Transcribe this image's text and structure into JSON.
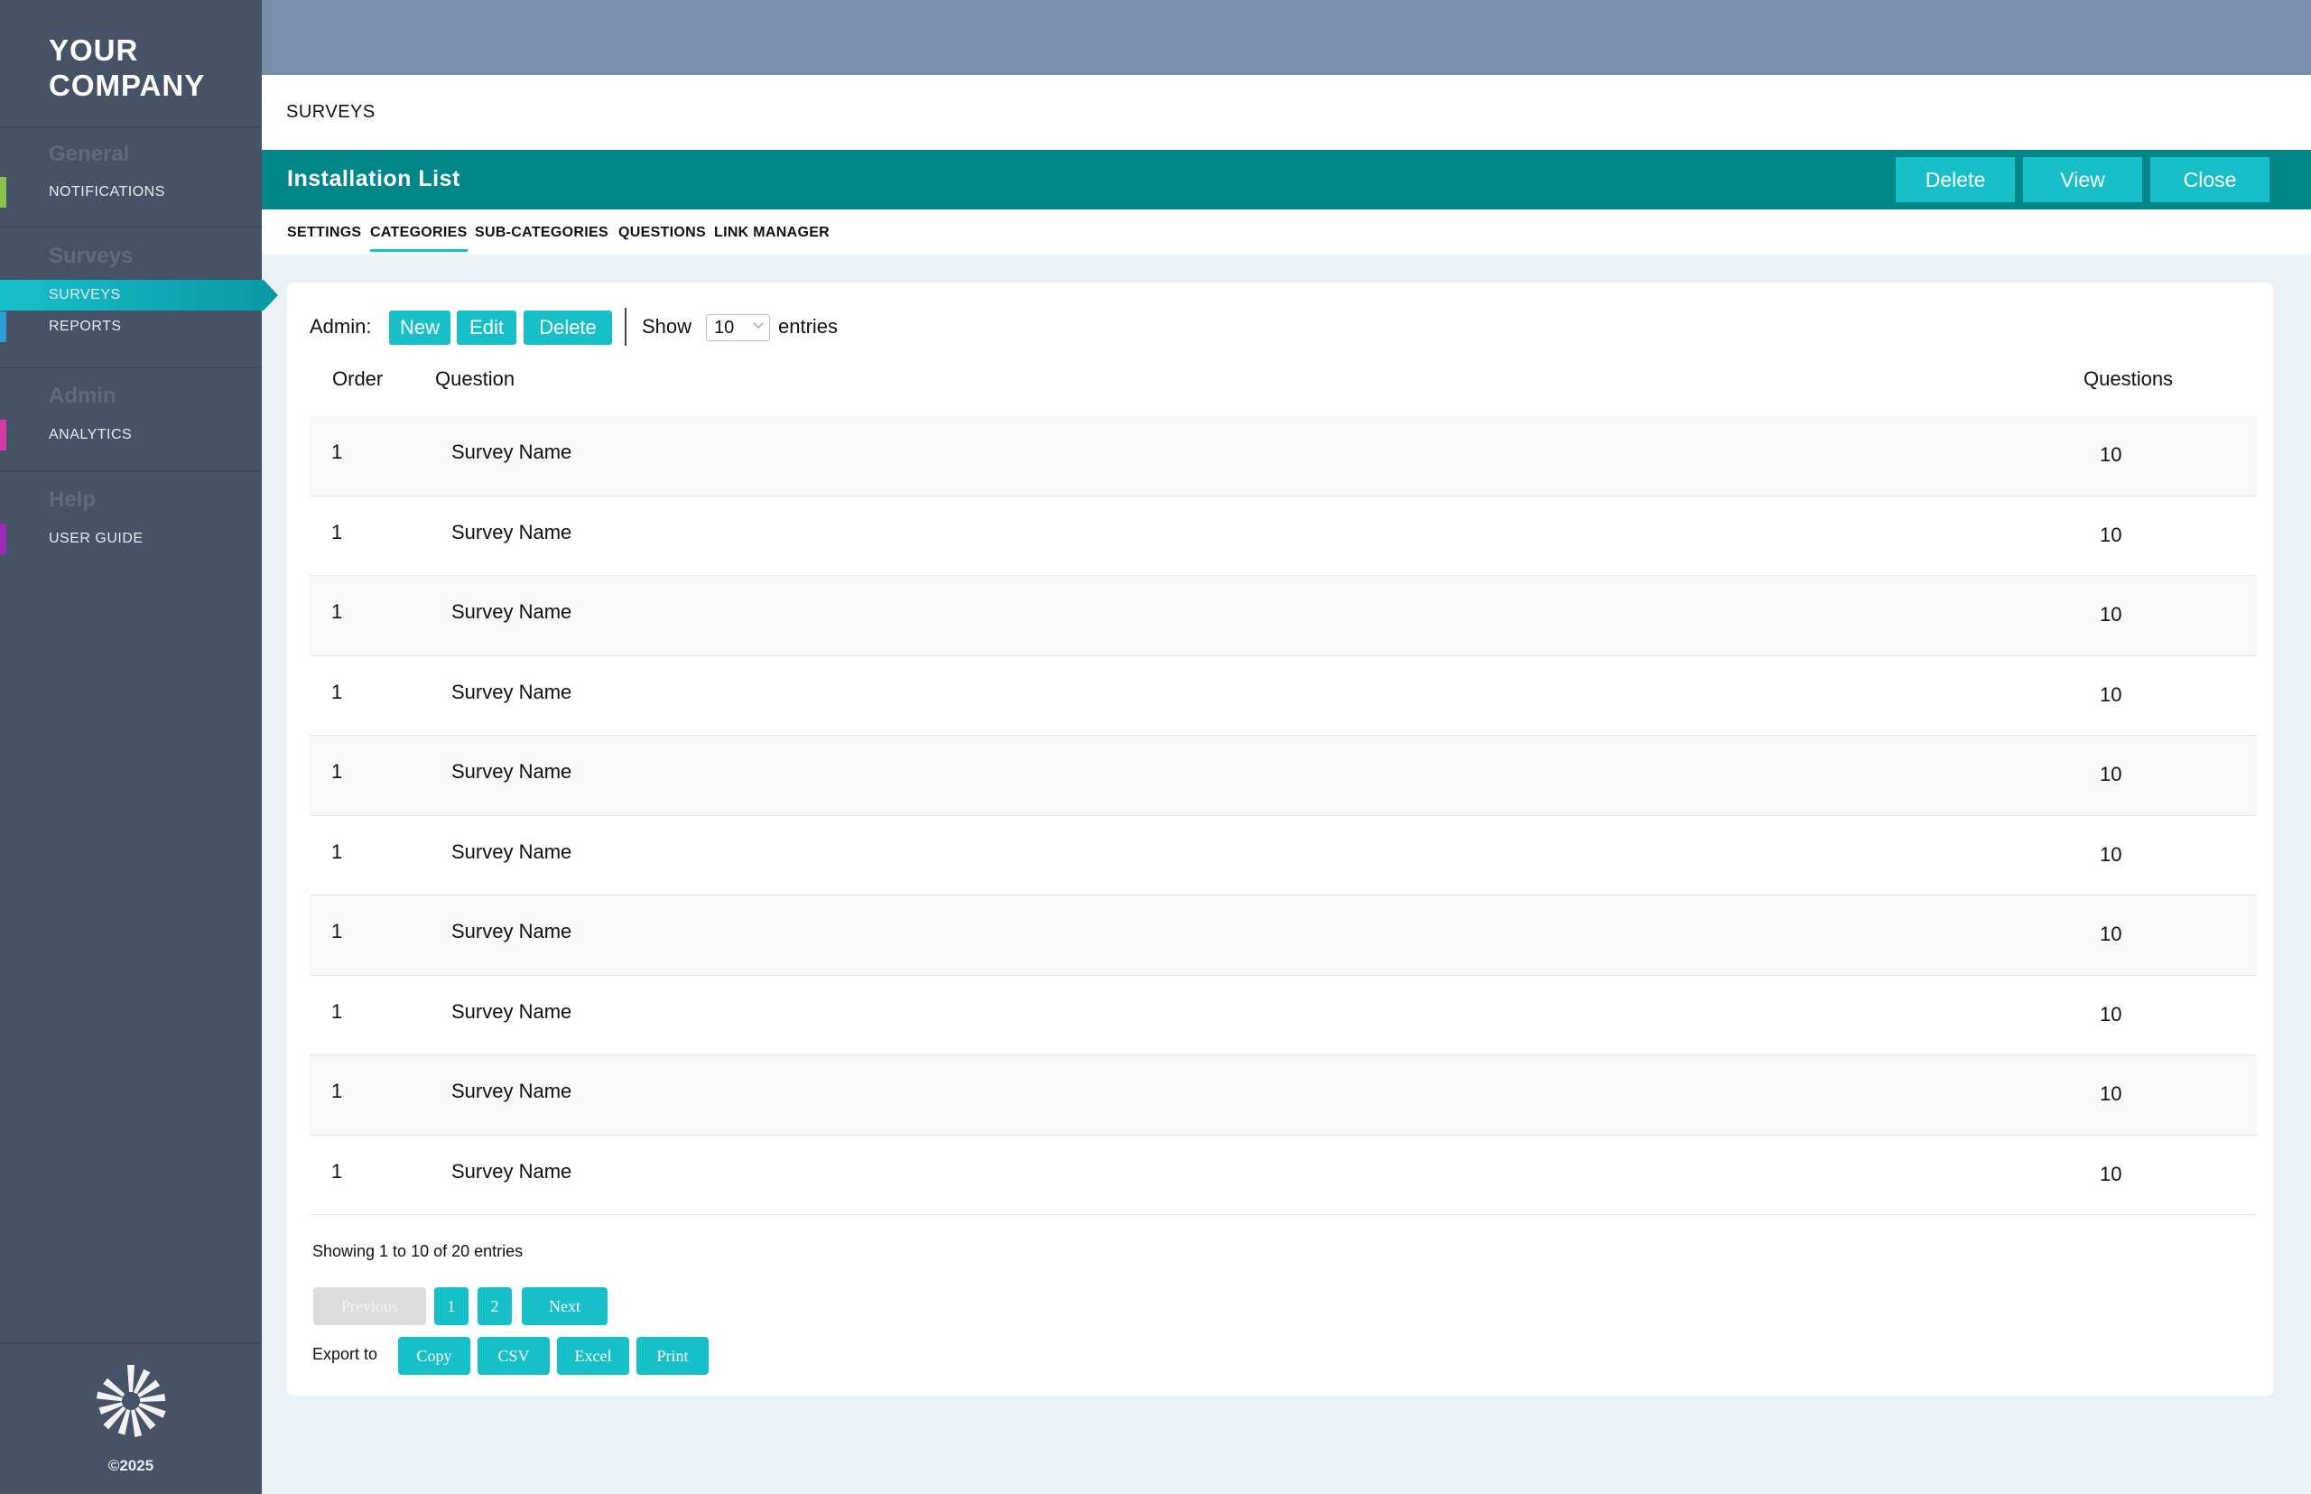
{
  "sidebar": {
    "logo_line1": "YOUR",
    "logo_line2": "COMPANY",
    "sections": [
      {
        "heading": "General",
        "items": [
          {
            "label": "NOTIFICATIONS",
            "accent": "#8bc34a"
          }
        ]
      },
      {
        "heading": "Surveys",
        "items": [
          {
            "label": "SURVEYS",
            "accent": "#17c0c9"
          },
          {
            "label": "REPORTS",
            "accent": "#2a9fd8"
          }
        ]
      },
      {
        "heading": "Admin",
        "items": [
          {
            "label": "ANALYTICS",
            "accent": "#d63aa8"
          }
        ]
      },
      {
        "heading": "Help",
        "items": [
          {
            "label": "USER GUIDE",
            "accent": "#9b2ab8"
          }
        ]
      }
    ],
    "copyright": "©2025"
  },
  "page": {
    "title": "SURVEYS",
    "header_title": "Installation List",
    "header_buttons": {
      "delete": "Delete",
      "view": "View",
      "close": "Close"
    }
  },
  "tabs": [
    "SETTINGS",
    "CATEGORIES",
    "SUB-CATEGORIES",
    "QUESTIONS",
    "LINK MANAGER"
  ],
  "active_tab": "CATEGORIES",
  "admin": {
    "label": "Admin:",
    "new": "New",
    "edit": "Edit",
    "delete": "Delete",
    "show_label": "Show",
    "show_value": "10",
    "entries_label": "entries"
  },
  "table": {
    "columns": [
      "Order",
      "Question",
      "Questions"
    ],
    "rows": [
      [
        "1",
        "Survey Name",
        "10"
      ],
      [
        "1",
        "Survey Name",
        "10"
      ],
      [
        "1",
        "Survey Name",
        "10"
      ],
      [
        "1",
        "Survey Name",
        "10"
      ],
      [
        "1",
        "Survey Name",
        "10"
      ],
      [
        "1",
        "Survey Name",
        "10"
      ],
      [
        "1",
        "Survey Name",
        "10"
      ],
      [
        "1",
        "Survey Name",
        "10"
      ],
      [
        "1",
        "Survey Name",
        "10"
      ],
      [
        "1",
        "Survey Name",
        "10"
      ]
    ]
  },
  "pagination": {
    "showing": "Showing 1 to 10 of 20 entries",
    "previous": "Previous",
    "pages": [
      "1",
      "2"
    ],
    "next": "Next"
  },
  "export": {
    "label": "Export to",
    "buttons": [
      "Copy",
      "CSV",
      "Excel",
      "Print"
    ]
  },
  "colors": {
    "accent": "#17c0c9",
    "header": "#01868a",
    "sidebar": "#465266",
    "topbar": "#788daa"
  }
}
